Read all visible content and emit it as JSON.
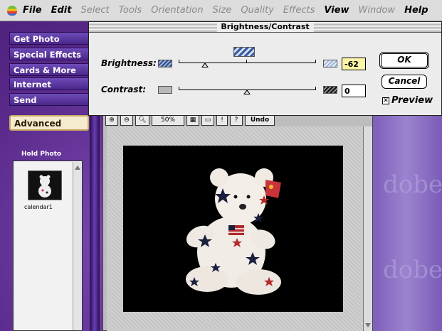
{
  "menubar": {
    "items": [
      "File",
      "Edit",
      "Select",
      "Tools",
      "Orientation",
      "Size",
      "Quality",
      "Effects",
      "View",
      "Window",
      "Help"
    ],
    "active": [
      "File",
      "Edit",
      "View",
      "Help"
    ]
  },
  "sidebar": {
    "items": [
      {
        "label": "Get Photo"
      },
      {
        "label": "Special Effects"
      },
      {
        "label": "Cards & More"
      },
      {
        "label": "Internet"
      },
      {
        "label": "Send"
      }
    ],
    "advanced_label": "Advanced",
    "hold_photo_label": "Hold Photo",
    "thumbnail_label": "calendar1"
  },
  "document": {
    "toolbar_zoom": "50%",
    "toolbar_undo": "Undo"
  },
  "dialog": {
    "title": "Brightness/Contrast",
    "brightness_label": "Brightness:",
    "brightness_value": "-62",
    "contrast_label": "Contrast:",
    "contrast_value": "0",
    "ok_label": "OK",
    "cancel_label": "Cancel",
    "preview_label": "Preview",
    "preview_checked": true
  },
  "watermark": [
    "dobe",
    "dobe"
  ],
  "colors": {
    "purple_bg": "#5a2a8c",
    "value_highlight": "#fff7a8"
  }
}
